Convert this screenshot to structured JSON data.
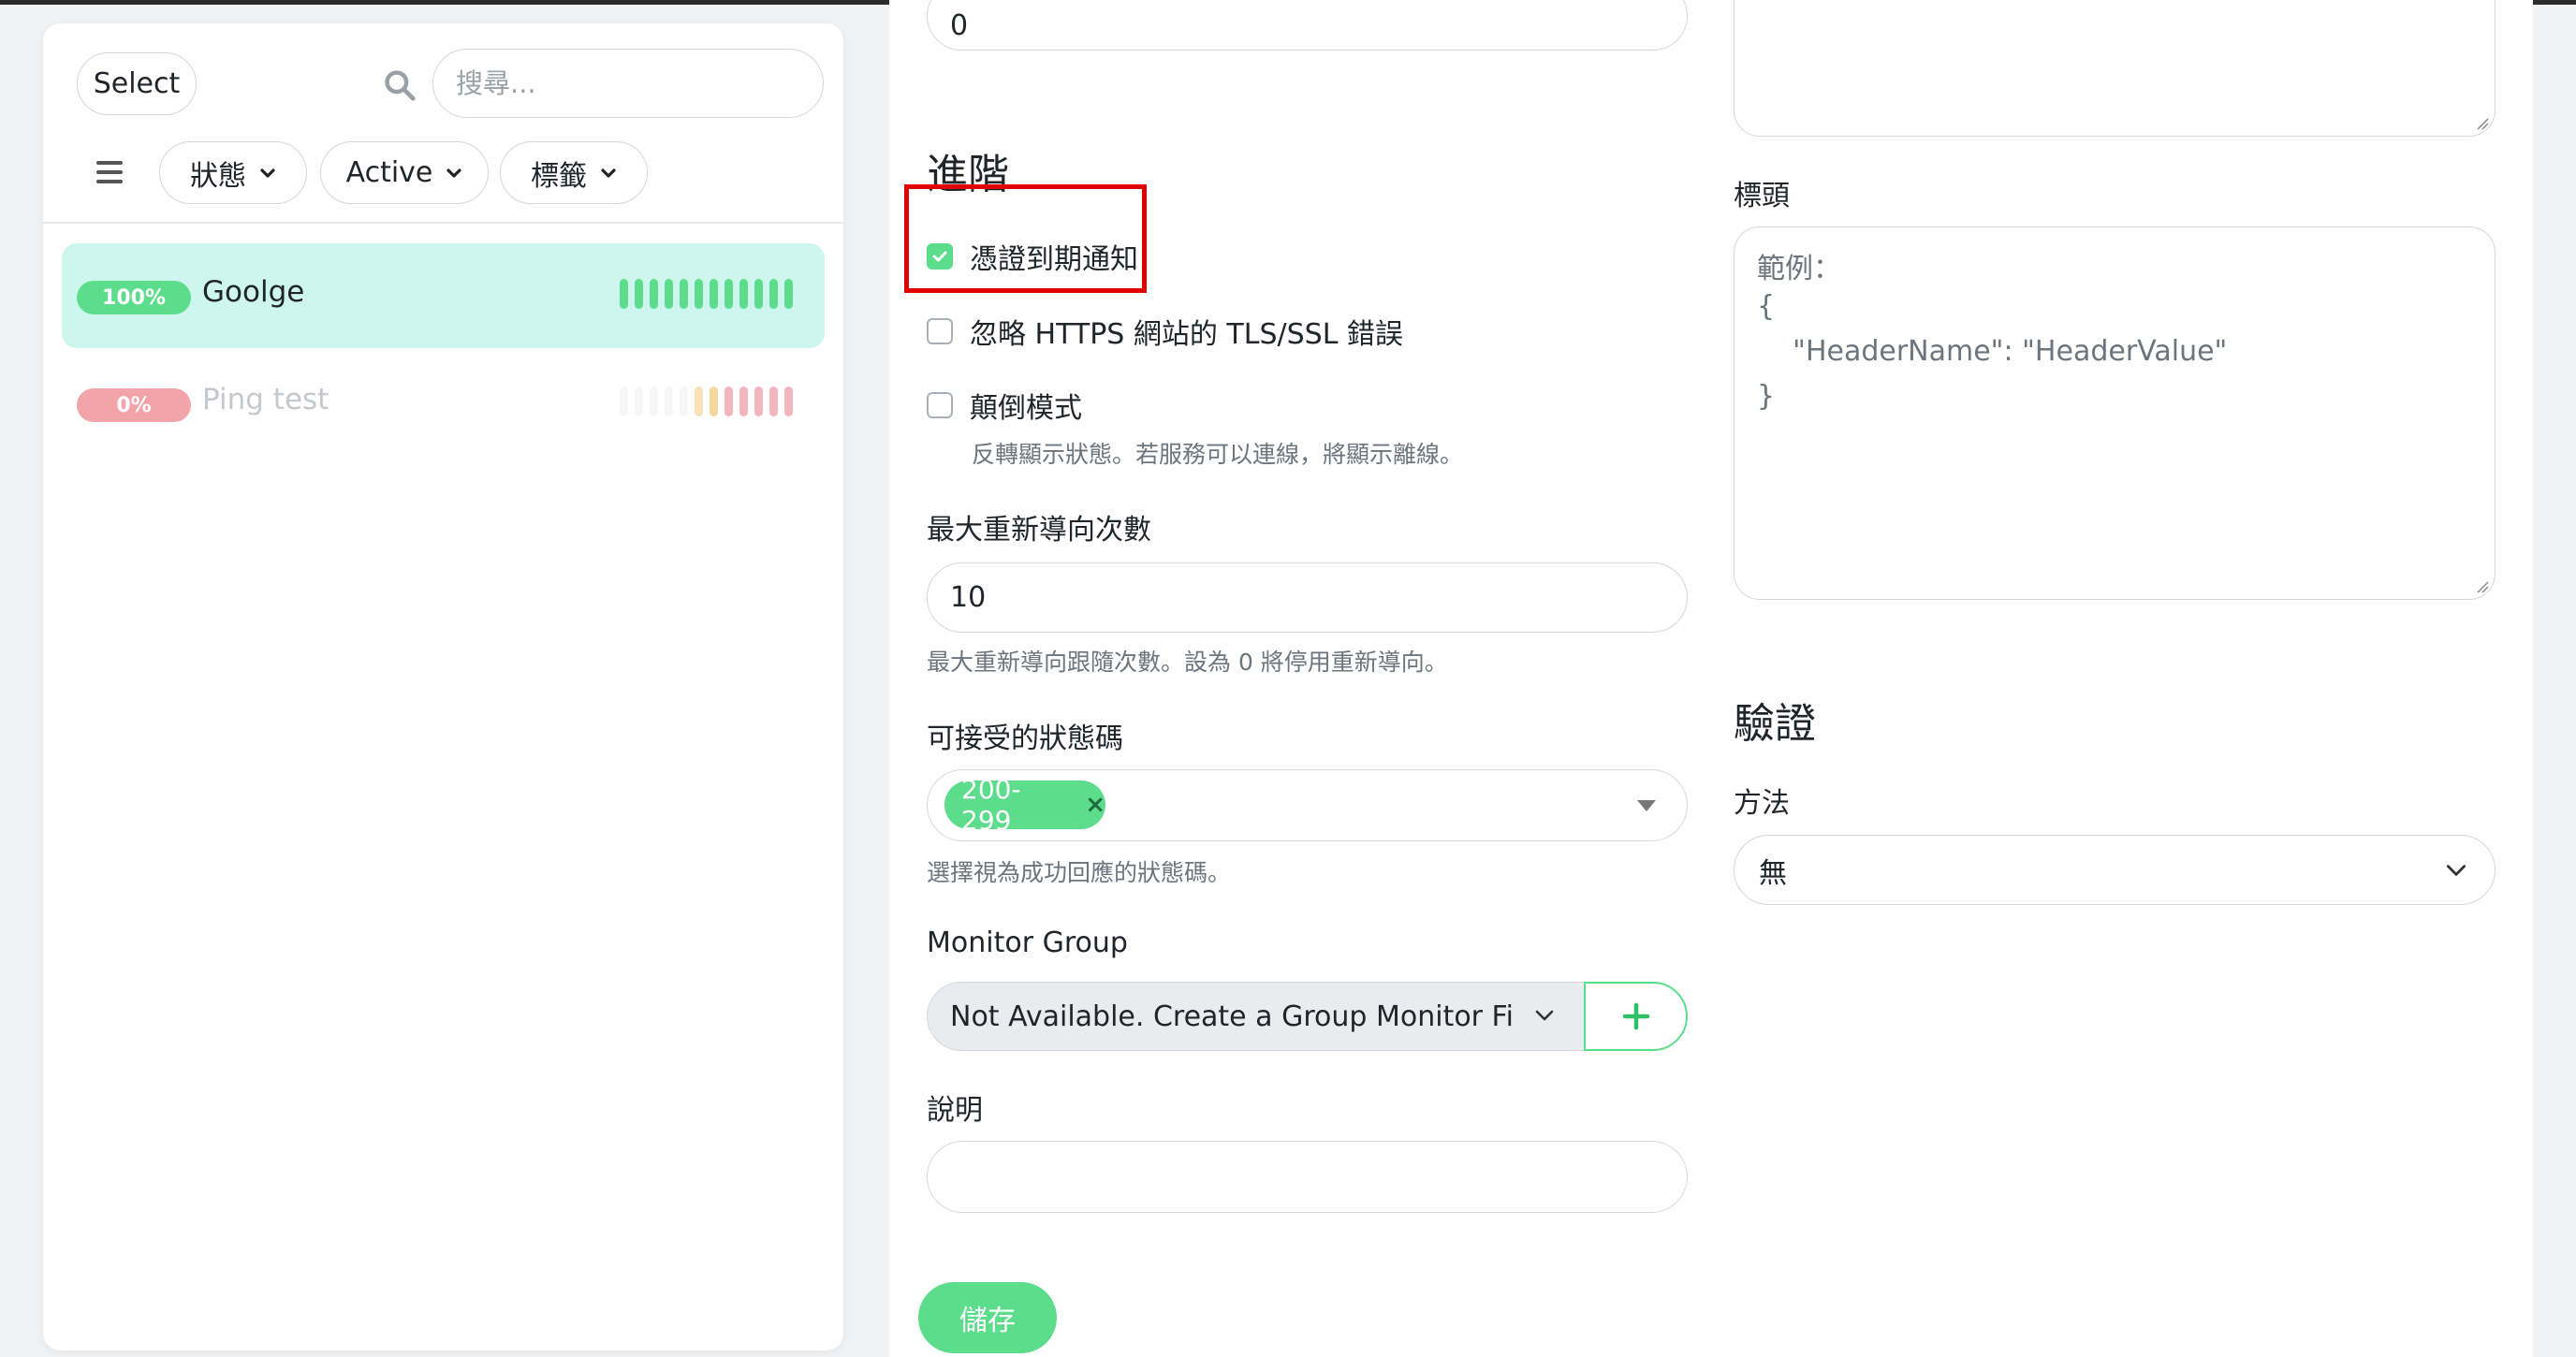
{
  "sidebar": {
    "select_label": "Select",
    "search_placeholder": "搜尋...",
    "filters": {
      "status": "狀態",
      "active": "Active",
      "tags": "標籤"
    },
    "monitors": [
      {
        "badge": "100%",
        "name": "Goolge",
        "uptime_percent": 100,
        "status_color": "#5cdd8b"
      },
      {
        "badge": "0%",
        "name": "Ping test",
        "uptime_percent": 0,
        "status_color": "#f3a3aa"
      }
    ]
  },
  "form": {
    "top_field_value": "0",
    "advanced_title": "進階",
    "cert_expiry_label": "憑證到期通知",
    "cert_expiry_checked": true,
    "ignore_tls_label": "忽略 HTTPS 網站的 TLS/SSL 錯誤",
    "ignore_tls_checked": false,
    "upside_down_label": "顛倒模式",
    "upside_down_checked": false,
    "upside_down_help": "反轉顯示狀態。若服務可以連線，將顯示離線。",
    "max_redirects_label": "最大重新導向次數",
    "max_redirects_value": "10",
    "max_redirects_help": "最大重新導向跟隨次數。設為 0 將停用重新導向。",
    "accepted_codes_label": "可接受的狀態碼",
    "accepted_code_tag": "200-299",
    "accepted_codes_help": "選擇視為成功回應的狀態碼。",
    "monitor_group_label": "Monitor Group",
    "monitor_group_value": "Not Available. Create a Group Monitor First",
    "description_label": "說明",
    "description_value": "",
    "save_label": "儲存"
  },
  "right": {
    "headers_label": "標頭",
    "headers_placeholder_lines": [
      "範例：",
      "{",
      "    \"HeaderName\": \"HeaderValue\"",
      "}"
    ],
    "auth_title": "驗證",
    "method_label": "方法",
    "method_value": "無"
  },
  "colors": {
    "accent": "#5cdd8b",
    "highlight_box": "#e00000",
    "selected_row": "#cdf6ef"
  }
}
